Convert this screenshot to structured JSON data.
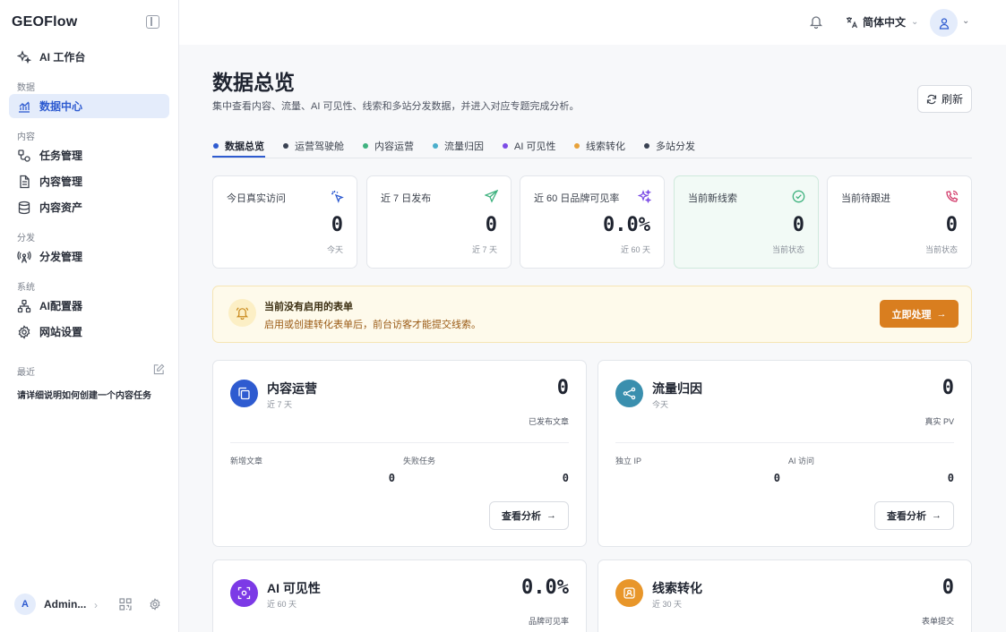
{
  "app": {
    "brand": "GEOFlow"
  },
  "sidebar": {
    "top_item": "AI 工作台",
    "sections": [
      {
        "label": "数据",
        "items": [
          "数据中心"
        ]
      },
      {
        "label": "内容",
        "items": [
          "任务管理",
          "内容管理",
          "内容资产"
        ]
      },
      {
        "label": "分发",
        "items": [
          "分发管理"
        ]
      },
      {
        "label": "系统",
        "items": [
          "AI配置器",
          "网站设置"
        ]
      }
    ],
    "active_item": "数据中心",
    "recent_label": "最近",
    "recent_item": "请详细说明如何创建一个内容任务",
    "user": {
      "initial": "A",
      "name": "Admin..."
    }
  },
  "topbar": {
    "language": "简体中文"
  },
  "page": {
    "title": "数据总览",
    "subtitle": "集中查看内容、流量、AI 可见性、线索和多站分发数据，并进入对应专题完成分析。",
    "refresh_label": "刷新"
  },
  "tabs": [
    {
      "label": "数据总览",
      "color": "#2e5bd0",
      "active": true
    },
    {
      "label": "运营驾驶舱",
      "color": "#3a4252"
    },
    {
      "label": "内容运营",
      "color": "#3fb27f"
    },
    {
      "label": "流量归因",
      "color": "#4aaecb"
    },
    {
      "label": "AI 可见性",
      "color": "#7c4ce6"
    },
    {
      "label": "线索转化",
      "color": "#e8a23a"
    },
    {
      "label": "多站分发",
      "color": "#3a4252"
    }
  ],
  "stats": [
    {
      "label": "今日真实访问",
      "value": "0",
      "caption": "今天",
      "icon": "cursor-click-icon",
      "color": "#2e5bd0"
    },
    {
      "label": "近 7 日发布",
      "value": "0",
      "caption": "近 7 天",
      "icon": "send-icon",
      "color": "#3fb27f"
    },
    {
      "label": "近 60 日品牌可见率",
      "value": "0.0%",
      "caption": "近 60 天",
      "icon": "sparkles-icon",
      "color": "#7c4ce6"
    },
    {
      "label": "当前新线索",
      "value": "0",
      "caption": "当前状态",
      "icon": "check-circle-icon",
      "color": "#3fb27f"
    },
    {
      "label": "当前待跟进",
      "value": "0",
      "caption": "当前状态",
      "icon": "phone-icon",
      "color": "#d23a6a"
    }
  ],
  "notice": {
    "title": "当前没有启用的表单",
    "text": "启用或创建转化表单后，前台访客才能提交线索。",
    "button": "立即处理"
  },
  "panels": [
    {
      "title": "内容运营",
      "period": "近 7 天",
      "value": "0",
      "caption": "已发布文章",
      "metrics": [
        {
          "label": "新增文章",
          "value": "0"
        },
        {
          "label": "失败任务",
          "value": "0"
        }
      ],
      "button": "查看分析",
      "icon": "copy-icon",
      "color": "#2e5bd0"
    },
    {
      "title": "流量归因",
      "period": "今天",
      "value": "0",
      "caption": "真实 PV",
      "metrics": [
        {
          "label": "独立 IP",
          "value": "0"
        },
        {
          "label": "AI 访问",
          "value": "0"
        }
      ],
      "button": "查看分析",
      "icon": "share-nodes-icon",
      "color": "#3a8fae"
    },
    {
      "title": "AI 可见性",
      "period": "近 60 天",
      "value": "0.0%",
      "caption": "品牌可见率",
      "icon": "scan-icon",
      "color": "#7c3ae6"
    },
    {
      "title": "线索转化",
      "period": "近 30 天",
      "value": "0",
      "caption": "表单提交",
      "icon": "user-square-icon",
      "color": "#e8962a"
    }
  ]
}
